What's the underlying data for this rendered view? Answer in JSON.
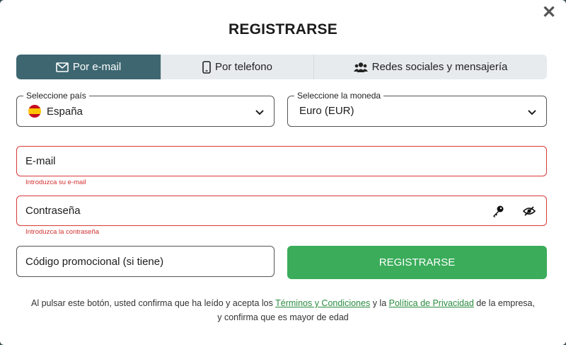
{
  "modal": {
    "title": "REGISTRARSE",
    "close_icon": "close-icon"
  },
  "tabs": [
    {
      "label": "Por e-mail",
      "icon": "envelope-icon",
      "active": true
    },
    {
      "label": "Por telefono",
      "icon": "phone-icon",
      "active": false
    },
    {
      "label": "Redes sociales y mensajería",
      "icon": "users-icon",
      "active": false
    }
  ],
  "country": {
    "legend": "Seleccione país",
    "value": "España",
    "flag": "spain-flag"
  },
  "currency": {
    "legend": "Seleccione la moneda",
    "value": "Euro (EUR)"
  },
  "email": {
    "placeholder": "E-mail",
    "error": "Introduzca su e-mail"
  },
  "password": {
    "placeholder": "Contraseña",
    "error": "Introduzca la contraseña",
    "generate_icon": "key-icon",
    "toggle_icon": "eye-slash-icon"
  },
  "promo": {
    "placeholder": "Código promocional (si tiene)"
  },
  "submit": {
    "label": "REGISTRARSE"
  },
  "legal": {
    "text_before": "Al pulsar este botón, usted confirma que ha leído y acepta los ",
    "terms_link": "Términos y Condiciones",
    "text_middle": " y la ",
    "privacy_link": "Política de Privacidad",
    "text_after": " de la empresa,",
    "line2": "y confirma que es mayor de edad"
  },
  "colors": {
    "active_tab": "#3d6670",
    "tabs_bg": "#e7ebee",
    "error": "#d83a3a",
    "submit": "#3aac5a",
    "link": "#2a8b3f"
  }
}
